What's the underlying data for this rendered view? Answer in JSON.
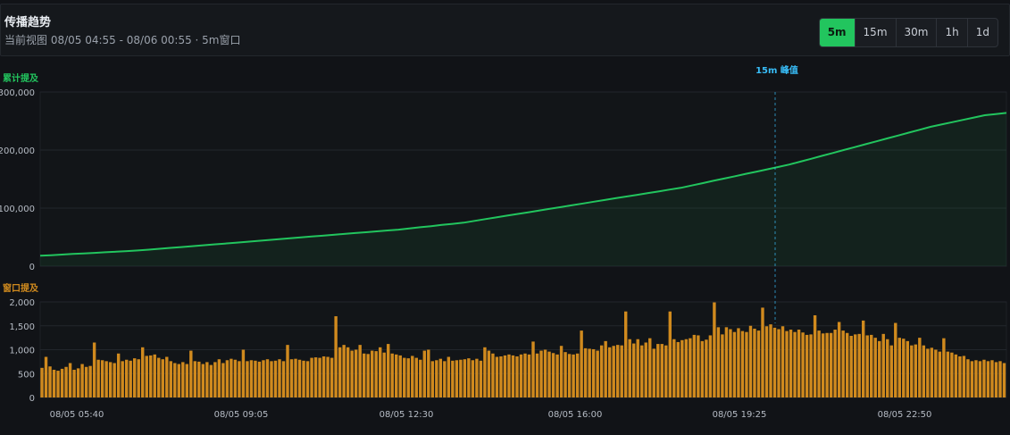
{
  "header": {
    "title": "传播趋势",
    "subtitle": "当前视图 08/05 04:55 - 08/06 00:55 · 5m窗口",
    "windows": [
      "5m",
      "15m",
      "30m",
      "1h",
      "1d"
    ],
    "active_window": "5m"
  },
  "colors": {
    "cumulative": "#22c55e",
    "window_bars": "#d08a1e",
    "peak_marker": "#38bdf8"
  },
  "chart_data": [
    {
      "type": "area",
      "ylabel": "累计提及",
      "yticks": [
        0,
        100000,
        200000,
        300000
      ],
      "ylim": [
        0,
        300000
      ],
      "x_range": [
        "08/05 04:55",
        "08/06 00:55"
      ],
      "series": [
        {
          "values": [
            18000,
            19000,
            20000,
            21000,
            22000,
            23000,
            24000,
            25000,
            26000,
            27000,
            28500,
            30000,
            31500,
            33000,
            34500,
            36000,
            37500,
            39000,
            40500,
            42000,
            43500,
            45000,
            46500,
            48000,
            49500,
            51000,
            52500,
            54000,
            55500,
            57000,
            58500,
            60000,
            61500,
            63000,
            65000,
            67000,
            69000,
            71000,
            73000,
            75000,
            78000,
            81000,
            84000,
            87000,
            90000,
            93000,
            96000,
            99000,
            102000,
            105000,
            108000,
            111000,
            114000,
            117000,
            120000,
            123000,
            126000,
            129000,
            132000,
            135000,
            139000,
            143000,
            147000,
            151000,
            155000,
            159000,
            163000,
            167000,
            171000,
            175000,
            180000,
            185000,
            190000,
            195000,
            200000,
            205000,
            210000,
            215000,
            220000,
            225000,
            230000,
            235000,
            240000,
            244000,
            248000,
            252000,
            256000,
            260000,
            262000,
            264000
          ]
        }
      ]
    },
    {
      "type": "bar",
      "ylabel": "窗口提及",
      "yticks": [
        0,
        500,
        1000,
        1500,
        2000
      ],
      "ylim": [
        0,
        2000
      ],
      "x_tick_labels": [
        "08/05 05:40",
        "08/05 09:05",
        "08/05 12:30",
        "08/05 16:00",
        "08/05 19:25",
        "08/05 22:50"
      ],
      "series": [
        {
          "values": [
            620,
            850,
            650,
            580,
            560,
            600,
            640,
            720,
            580,
            610,
            700,
            640,
            660,
            1150,
            790,
            780,
            760,
            740,
            720,
            920,
            760,
            790,
            770,
            820,
            800,
            1050,
            870,
            880,
            900,
            830,
            800,
            850,
            760,
            720,
            700,
            740,
            700,
            980,
            760,
            750,
            700,
            740,
            680,
            740,
            800,
            720,
            780,
            810,
            790,
            760,
            1000,
            760,
            780,
            770,
            750,
            780,
            800,
            760,
            770,
            800,
            760,
            1100,
            800,
            810,
            790,
            770,
            760,
            830,
            840,
            830,
            860,
            850,
            830,
            1700,
            1050,
            1100,
            1050,
            980,
            1000,
            1100,
            920,
            910,
            980,
            970,
            1050,
            940,
            1120,
            920,
            900,
            880,
            830,
            820,
            870,
            830,
            790,
            980,
            1000,
            760,
            780,
            810,
            760,
            850,
            770,
            780,
            790,
            800,
            820,
            780,
            810,
            770,
            1050,
            980,
            920,
            850,
            860,
            880,
            900,
            880,
            860,
            900,
            920,
            900,
            1170,
            920,
            980,
            1000,
            960,
            930,
            900,
            1080,
            950,
            910,
            900,
            920,
            1400,
            1030,
            1020,
            1010,
            980,
            1090,
            1180,
            1050,
            1080,
            1100,
            1090,
            1800,
            1220,
            1130,
            1220,
            1090,
            1150,
            1240,
            1020,
            1120,
            1120,
            1090,
            1800,
            1220,
            1160,
            1200,
            1220,
            1240,
            1310,
            1300,
            1180,
            1210,
            1300,
            1990,
            1470,
            1320,
            1470,
            1430,
            1370,
            1450,
            1390,
            1370,
            1500,
            1440,
            1400,
            1880,
            1490,
            1530,
            1460,
            1430,
            1490,
            1390,
            1420,
            1370,
            1420,
            1360,
            1310,
            1320,
            1720,
            1400,
            1340,
            1350,
            1350,
            1420,
            1580,
            1400,
            1350,
            1290,
            1320,
            1330,
            1610,
            1300,
            1310,
            1250,
            1180,
            1330,
            1220,
            1090,
            1560,
            1250,
            1230,
            1180,
            1090,
            1110,
            1250,
            1090,
            1020,
            1040,
            1000,
            960,
            1240,
            960,
            940,
            900,
            860,
            870,
            800,
            760,
            780,
            760,
            790,
            760,
            780,
            740,
            760,
            720
          ]
        }
      ],
      "annotations": [
        "15m 峰值"
      ]
    }
  ]
}
